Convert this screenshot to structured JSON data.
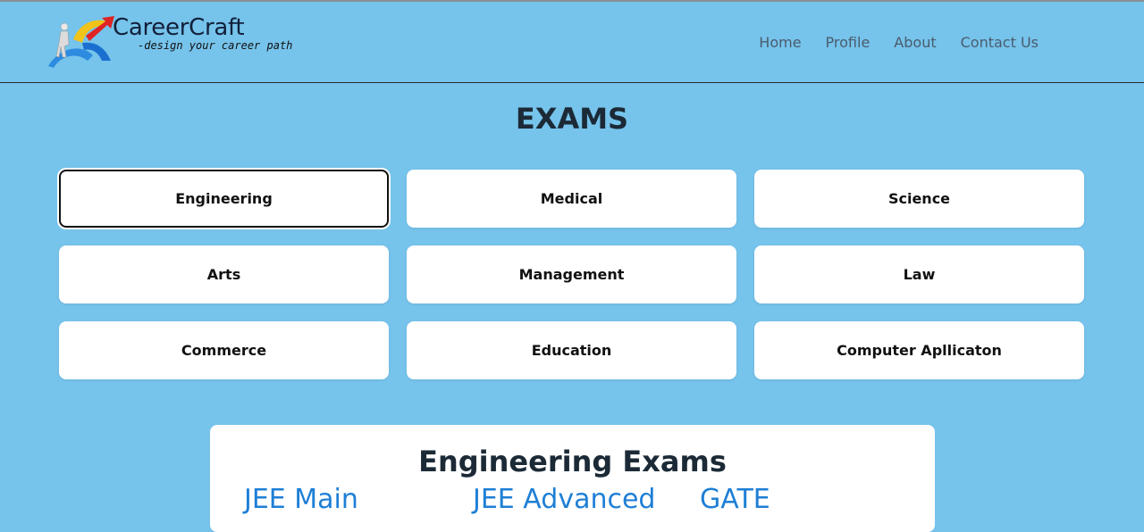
{
  "brand": {
    "name": "CareerCraft",
    "tagline": "-design your career path"
  },
  "nav": {
    "items": [
      {
        "label": "Home"
      },
      {
        "label": "Profile"
      },
      {
        "label": "About"
      },
      {
        "label": "Contact Us"
      }
    ]
  },
  "page": {
    "title": "EXAMS"
  },
  "categories": {
    "selected": "Engineering",
    "items": [
      {
        "label": "Engineering"
      },
      {
        "label": "Medical"
      },
      {
        "label": "Science"
      },
      {
        "label": "Arts"
      },
      {
        "label": "Management"
      },
      {
        "label": "Law"
      },
      {
        "label": "Commerce"
      },
      {
        "label": "Education"
      },
      {
        "label": "Computer Apllicaton"
      }
    ]
  },
  "panel": {
    "title": "Engineering Exams",
    "exams": [
      {
        "label": "JEE Main"
      },
      {
        "label": "JEE Advanced"
      },
      {
        "label": "GATE"
      }
    ]
  },
  "colors": {
    "background": "#76c3eb",
    "card": "#ffffff",
    "link": "#1e7fd6"
  }
}
